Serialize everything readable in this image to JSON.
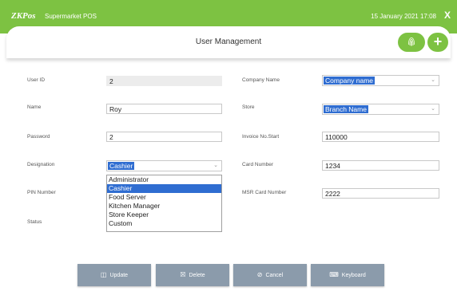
{
  "header": {
    "logo": "ZKPos",
    "app_name": "Supermarket POS",
    "datetime": "15 January 2021 17:08",
    "close": "X",
    "accent": "#7dc242"
  },
  "page": {
    "title": "User Management",
    "add_label": "+"
  },
  "form": {
    "user_id": {
      "label": "User ID",
      "value": "2"
    },
    "name": {
      "label": "Name",
      "value": "Roy"
    },
    "password": {
      "label": "Password",
      "value": "2"
    },
    "designation": {
      "label": "Designation",
      "value": "Cashier",
      "options": [
        "Administrator",
        "Cashier",
        "Food Server",
        "Kitchen Manager",
        "Store Keeper",
        "Custom"
      ],
      "selected_index": 1
    },
    "pin": {
      "label": "PIN Number"
    },
    "status": {
      "label": "Status"
    },
    "company": {
      "label": "Company Name",
      "value": "Company name"
    },
    "store": {
      "label": "Store",
      "value": "Branch Name"
    },
    "invoice": {
      "label": "Invoice No.Start",
      "value": "110000"
    },
    "card": {
      "label": "Card Number",
      "value": "1234"
    },
    "msr": {
      "label": "MSR Card Number",
      "value": "2222"
    }
  },
  "buttons": {
    "update": "Update",
    "delete": "Delete",
    "cancel": "Cancel",
    "keyboard": "Keyboard"
  },
  "colors": {
    "button": "#8b9bab",
    "highlight": "#2f6dd1"
  }
}
